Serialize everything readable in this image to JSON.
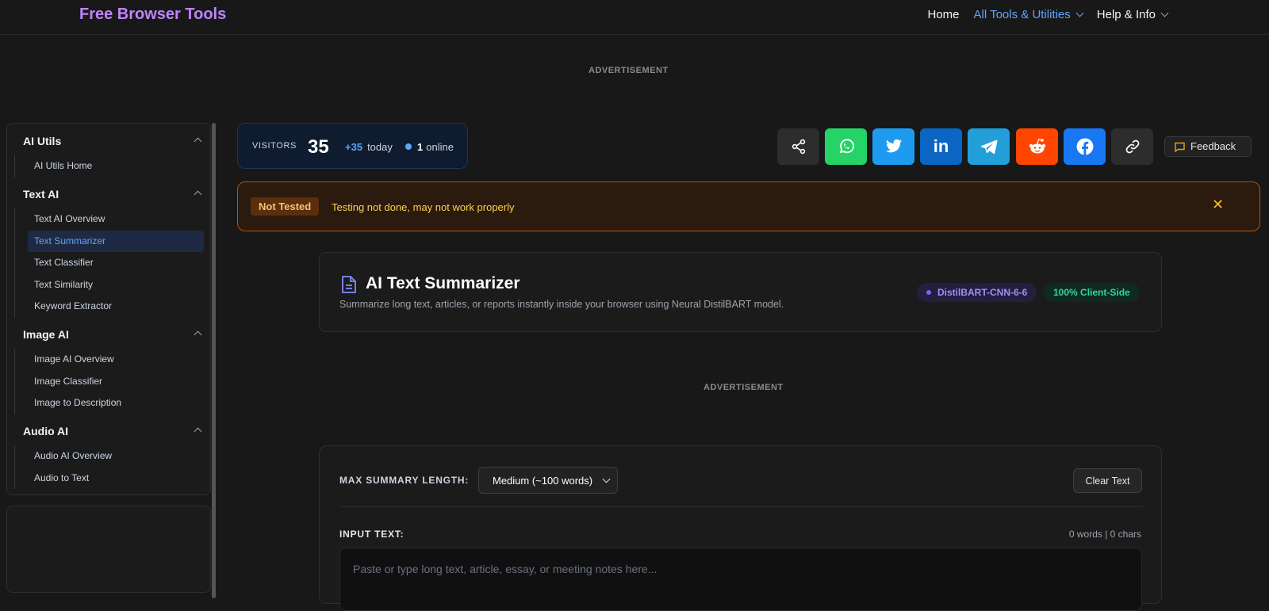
{
  "header": {
    "brand": "Free Browser Tools",
    "nav": [
      {
        "label": "Home"
      },
      {
        "label": "All Tools & Utilities"
      },
      {
        "label": "Help & Info"
      }
    ]
  },
  "ads": {
    "label": "ADVERTISEMENT"
  },
  "sidebar": {
    "sections": [
      {
        "title": "AI Utils",
        "items": [
          "AI Utils Home"
        ]
      },
      {
        "title": "Text AI",
        "items": [
          "Text AI Overview",
          "Text Summarizer",
          "Text Classifier",
          "Text Similarity",
          "Keyword Extractor"
        ]
      },
      {
        "title": "Image AI",
        "items": [
          "Image AI Overview",
          "Image Classifier",
          "Image to Description"
        ]
      },
      {
        "title": "Audio AI",
        "items": [
          "Audio AI Overview",
          "Audio to Text"
        ]
      }
    ],
    "selected": "Text Summarizer"
  },
  "visitors": {
    "label": "VISITORS",
    "total": "35",
    "today_count": "+35",
    "today_label": "today",
    "online_count": "1",
    "online_label": "online"
  },
  "share": {
    "buttons": [
      {
        "icon": "share-icon",
        "color": "#2d2d2d"
      },
      {
        "icon": "whatsapp-icon",
        "color": "#25d366"
      },
      {
        "icon": "twitter-icon",
        "color": "#1d9bf0"
      },
      {
        "icon": "linkedin-icon",
        "color": "#0a66c2"
      },
      {
        "icon": "telegram-icon",
        "color": "#229ed9"
      },
      {
        "icon": "reddit-icon",
        "color": "#ff4500"
      },
      {
        "icon": "facebook-icon",
        "color": "#1877f2"
      },
      {
        "icon": "link-icon",
        "color": "#2d2d2d"
      }
    ],
    "feedback_label": "Feedback"
  },
  "warning": {
    "badge": "Not Tested",
    "message": "Testing not done, may not work properly"
  },
  "tool": {
    "title": "AI Text Summarizer",
    "description": "Summarize long text, articles, or reports instantly inside your browser using Neural DistilBART model.",
    "model_chip": "DistilBART-CNN-6-6",
    "client_chip": "100% Client-Side"
  },
  "controls": {
    "max_length_label": "MAX SUMMARY LENGTH:",
    "max_length_value": "Medium (~100 words)",
    "clear_label": "Clear Text",
    "input_label": "INPUT TEXT:",
    "counts": "0 words | 0 chars",
    "input_placeholder": "Paste or type long text, article, essay, or meeting notes here..."
  }
}
